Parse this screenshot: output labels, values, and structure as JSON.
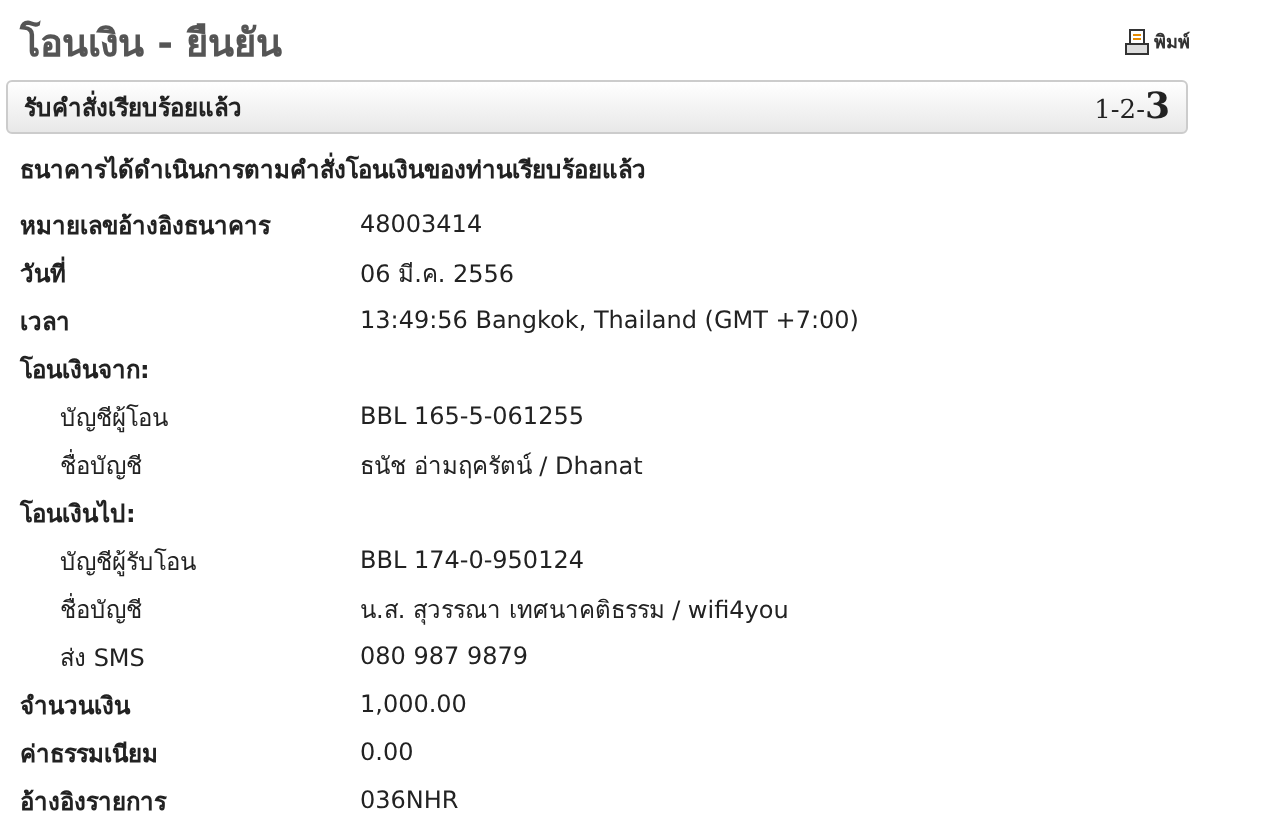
{
  "title": "โอนเงิน - ยืนยัน",
  "print_link": "พิมพ์",
  "status_bar": {
    "text": "รับคำสั่งเรียบร้อยแล้ว",
    "steps": [
      {
        "label": "1-",
        "selected": false
      },
      {
        "label": "2-",
        "selected": false
      },
      {
        "label": "3",
        "selected": true
      }
    ]
  },
  "message": "ธนาคารได้ดำเนินการตามคำสั่งโอนเงินของท่านเรียบร้อยแล้ว",
  "rows": [
    {
      "label": "หมายเลขอ้างอิงธนาคาร",
      "value": "48003414"
    },
    {
      "label": "วันที่",
      "value": "06 มี.ค. 2556"
    },
    {
      "label": "เวลา",
      "value": "13:49:56 Bangkok, Thailand (GMT +7:00)"
    },
    {
      "label": "โอนเงินจาก:",
      "children": [
        {
          "label": "บัญชีผู้โอน",
          "value": "BBL 165-5-061255"
        },
        {
          "label": "ชื่อบัญชี",
          "value": "ธนัช อ่ามฤครัตน์ / Dhanat"
        }
      ]
    },
    {
      "label": "โอนเงินไป:",
      "children": [
        {
          "label": "บัญชีผู้รับโอน",
          "value": "BBL 174-0-950124"
        },
        {
          "label": "ชื่อบัญชี",
          "value": "น.ส. สุวรรณา เทศนาคติธรรม / wifi4you"
        },
        {
          "label": "ส่ง SMS",
          "value": "080 987 9879"
        }
      ]
    },
    {
      "label": "จำนวนเงิน",
      "value": "1,000.00"
    },
    {
      "label": "ค่าธรรมเนียม",
      "value": "0.00"
    },
    {
      "label": "อ้างอิงรายการ",
      "value": "036NHR"
    }
  ]
}
